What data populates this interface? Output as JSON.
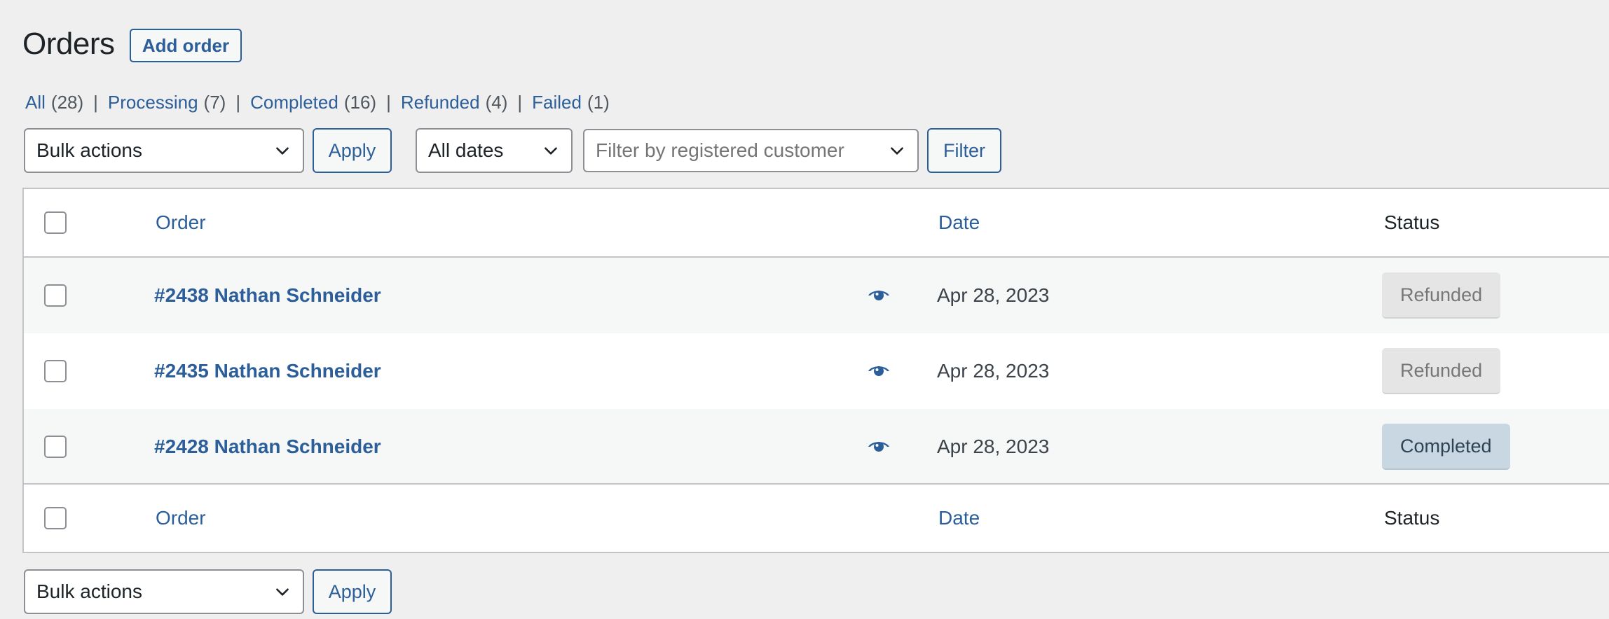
{
  "header": {
    "title": "Orders",
    "add_button": "Add order"
  },
  "filters_nav": [
    {
      "label": "All",
      "count": "(28)"
    },
    {
      "label": "Processing",
      "count": "(7)"
    },
    {
      "label": "Completed",
      "count": "(16)"
    },
    {
      "label": "Refunded",
      "count": "(4)"
    },
    {
      "label": "Failed",
      "count": "(1)"
    }
  ],
  "filters_nav_separator": "|",
  "toolbar": {
    "bulk_actions": "Bulk actions",
    "apply": "Apply",
    "dates": "All dates",
    "customer_placeholder": "Filter by registered customer",
    "filter": "Filter"
  },
  "table": {
    "columns": {
      "order": "Order",
      "date": "Date",
      "status": "Status"
    },
    "rows": [
      {
        "order": "#2438 Nathan Schneider",
        "date": "Apr 28, 2023",
        "status": "Refunded"
      },
      {
        "order": "#2435 Nathan Schneider",
        "date": "Apr 28, 2023",
        "status": "Refunded"
      },
      {
        "order": "#2428 Nathan Schneider",
        "date": "Apr 28, 2023",
        "status": "Completed"
      }
    ]
  },
  "bottom_toolbar": {
    "bulk_actions": "Bulk actions",
    "apply": "Apply"
  },
  "icons": {
    "preview": "eye-icon",
    "dropdown": "chevron-down-icon"
  },
  "colors": {
    "link": "#2c5e9a",
    "refunded_bg": "#e5e5e5",
    "completed_bg": "#c8d7e1"
  }
}
